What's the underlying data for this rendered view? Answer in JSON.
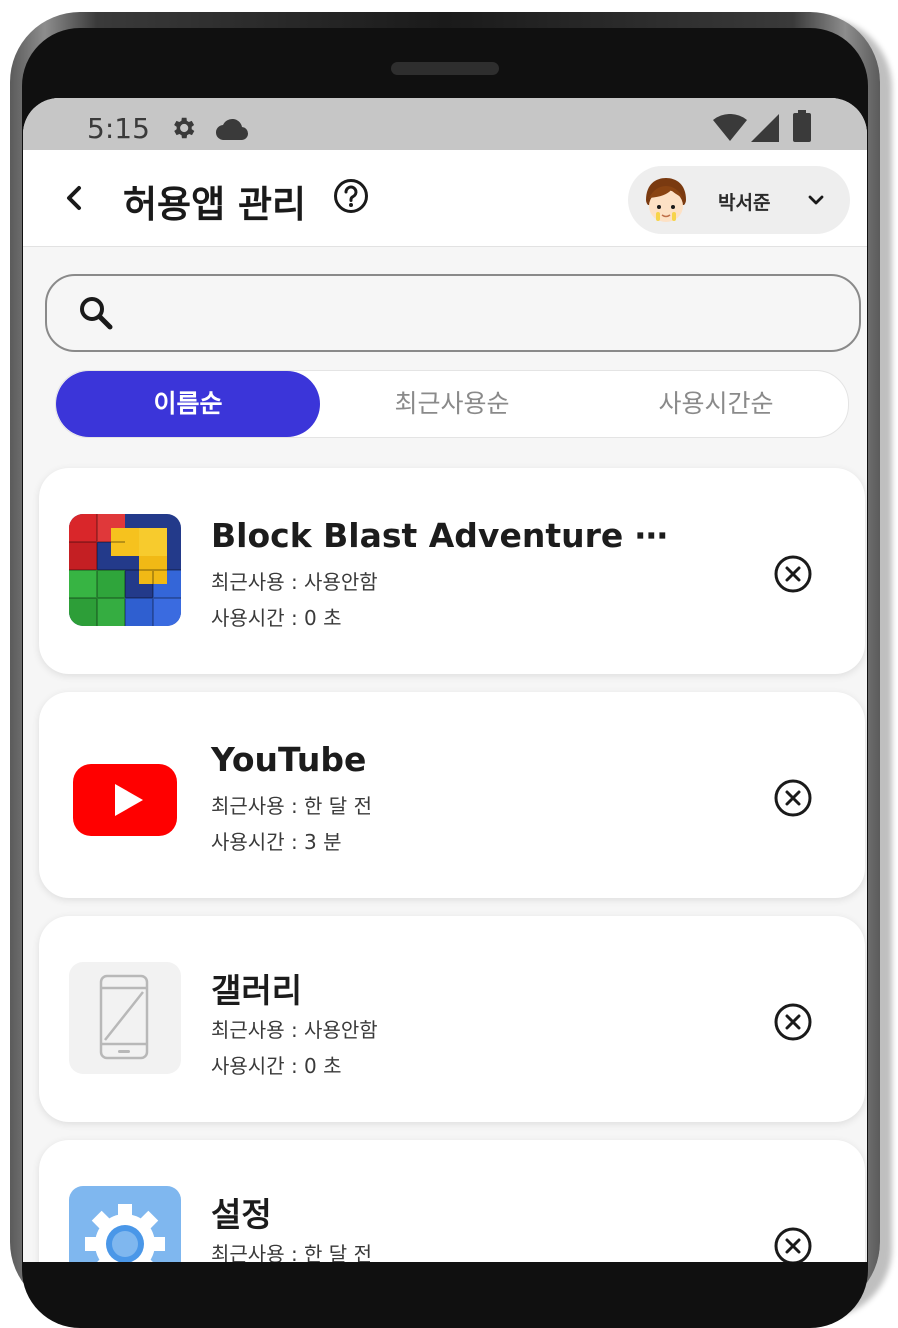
{
  "status_bar": {
    "time": "5:15",
    "icons": [
      "gear-icon",
      "cloud-icon",
      "wifi-icon",
      "signal-icon",
      "battery-icon"
    ]
  },
  "header": {
    "title": "허용앱 관리",
    "back_icon": "chevron-left-icon",
    "help_icon": "question-circle-icon",
    "user": {
      "name": "박서준",
      "avatar_icon": "avatar-icon",
      "dropdown_icon": "chevron-down-icon"
    }
  },
  "search": {
    "icon": "search-icon",
    "value": "",
    "placeholder": ""
  },
  "sort_tabs": [
    {
      "label": "이름순",
      "active": true
    },
    {
      "label": "최근사용순",
      "active": false
    },
    {
      "label": "사용시간순",
      "active": false
    }
  ],
  "apps": [
    {
      "name": "Block Blast Adventure ⋯",
      "recent": "최근사용 : 사용안함",
      "usage": "사용시간 : 0 초",
      "icon": "block-blast-icon"
    },
    {
      "name": "YouTube",
      "recent": "최근사용 : 한 달 전",
      "usage": "사용시간 : 3 분",
      "icon": "youtube-icon"
    },
    {
      "name": "갤러리",
      "recent": "최근사용 : 사용안함",
      "usage": "사용시간 : 0 초",
      "icon": "phone-placeholder-icon"
    },
    {
      "name": "설정",
      "recent": "최근사용 : 한 달 전",
      "usage": "",
      "icon": "settings-gear-icon"
    }
  ],
  "colors": {
    "accent": "#3b35d9",
    "status_bar": "#c6c6c6",
    "background": "#f6f6f6",
    "youtube_red": "#ff0000",
    "settings_blue": "#7fb7ef"
  }
}
